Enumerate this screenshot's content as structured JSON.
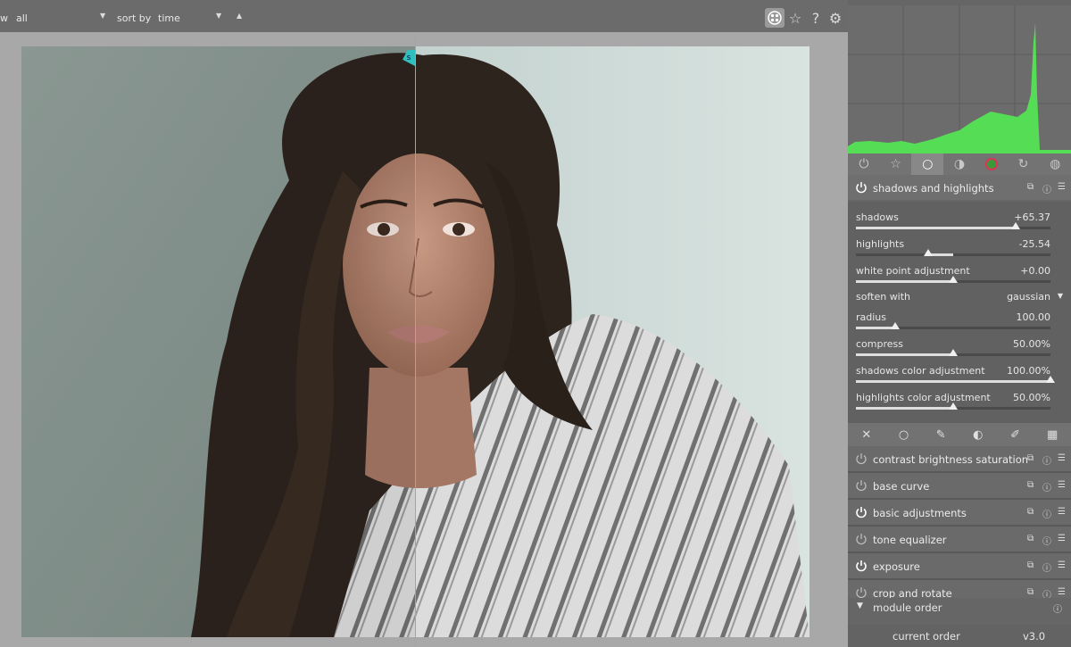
{
  "topbar": {
    "view_prefix": "w",
    "filter_value": "all",
    "sort_label": "sort by",
    "sort_value": "time",
    "icons": [
      "grouping-icon",
      "star-icon",
      "help-icon",
      "gear-icon"
    ]
  },
  "viewer": {
    "split_handle_label": "s"
  },
  "panel": {
    "tabs": [
      "power-icon",
      "star-icon",
      "circle-icon",
      "gradient-circle-icon",
      "color-circle-icon",
      "rotate-circle-icon",
      "texture-circle-icon"
    ],
    "active_tab": 2,
    "active_module": {
      "title": "shadows and highlights",
      "sliders": [
        {
          "label": "shadows",
          "value": "+65.37",
          "level": 0.82
        },
        {
          "label": "highlights",
          "value": "-25.54",
          "level": 0.37
        },
        {
          "label": "white point adjustment",
          "value": "+0.00",
          "level": 0.5
        },
        {
          "label": "radius",
          "value": "100.00",
          "level": 0.2
        },
        {
          "label": "compress",
          "value": "50.00%",
          "level": 0.5
        },
        {
          "label": "shadows color adjustment",
          "value": "100.00%",
          "level": 1.0
        },
        {
          "label": "highlights color adjustment",
          "value": "50.00%",
          "level": 0.5
        }
      ],
      "soften_label": "soften with",
      "soften_value": "gaussian"
    },
    "mask_icons": [
      "off-icon",
      "uniform-circle-icon",
      "drawn-mask-icon",
      "parametric-icon",
      "drawn-parametric-icon",
      "raster-icon"
    ],
    "modules": [
      {
        "name": "contrast brightness saturation",
        "enabled": false
      },
      {
        "name": "base curve",
        "enabled": false
      },
      {
        "name": "basic adjustments",
        "enabled": true
      },
      {
        "name": "tone equalizer",
        "enabled": false
      },
      {
        "name": "exposure",
        "enabled": true
      },
      {
        "name": "crop and rotate",
        "enabled": false
      }
    ],
    "module_order": {
      "title": "module order",
      "current_label": "current order",
      "current_value": "v3.0"
    }
  }
}
